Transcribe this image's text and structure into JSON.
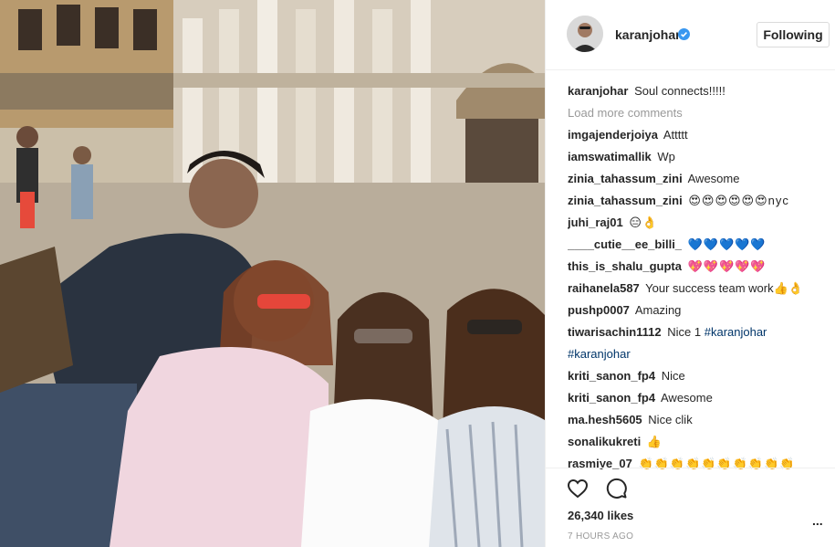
{
  "post": {
    "username": "karanjohar",
    "follow_label": "Following",
    "caption_user": "karanjohar",
    "caption_text": "Soul connects!!!!!",
    "load_more": "Load more comments",
    "likes": "26,340 likes",
    "time": "7 HOURS AGO",
    "more_label": "..."
  },
  "comments": [
    {
      "user": "imgajenderjoiya",
      "text": "Attttt"
    },
    {
      "user": "iamswatimallik",
      "text": "Wp"
    },
    {
      "user": "zinia_tahassum_zini",
      "text": "Awesome"
    },
    {
      "user": "zinia_tahassum_zini",
      "text": "😍😍😍😍😍😍nyc"
    },
    {
      "user": "juhi_raj01",
      "text": "😑👌"
    },
    {
      "user": "____cutie__ee_billi_",
      "text": "💙💙💙💙💙"
    },
    {
      "user": "this_is_shalu_gupta",
      "text": "💖💖💖💖💖"
    },
    {
      "user": "raihanela587",
      "text": "Your success team work👍👌"
    },
    {
      "user": "pushp0007",
      "text": "Amazing"
    },
    {
      "user": "tiwarisachin1112",
      "text": "Nice 1",
      "tag1": "#karanjohar",
      "tag2": "#karanjohar"
    },
    {
      "user": "kriti_sanon_fp4",
      "text": "Nice"
    },
    {
      "user": "kriti_sanon_fp4",
      "text": "Awesome"
    },
    {
      "user": "ma.hesh5605",
      "text": "Nice clik"
    },
    {
      "user": "sonalikukreti",
      "text": "👍"
    },
    {
      "user": "rasmiye_07",
      "text": "👏👏👏👏👏👏👏👏👏👏"
    }
  ],
  "colors": {
    "verified": "#3897f0",
    "muted": "#999999",
    "hashtag": "#003569",
    "border": "#dbdbdb"
  },
  "icons": {
    "verified": "verified-badge-icon",
    "like": "heart-icon",
    "comment": "comment-bubble-icon",
    "more": "more-options-icon"
  }
}
